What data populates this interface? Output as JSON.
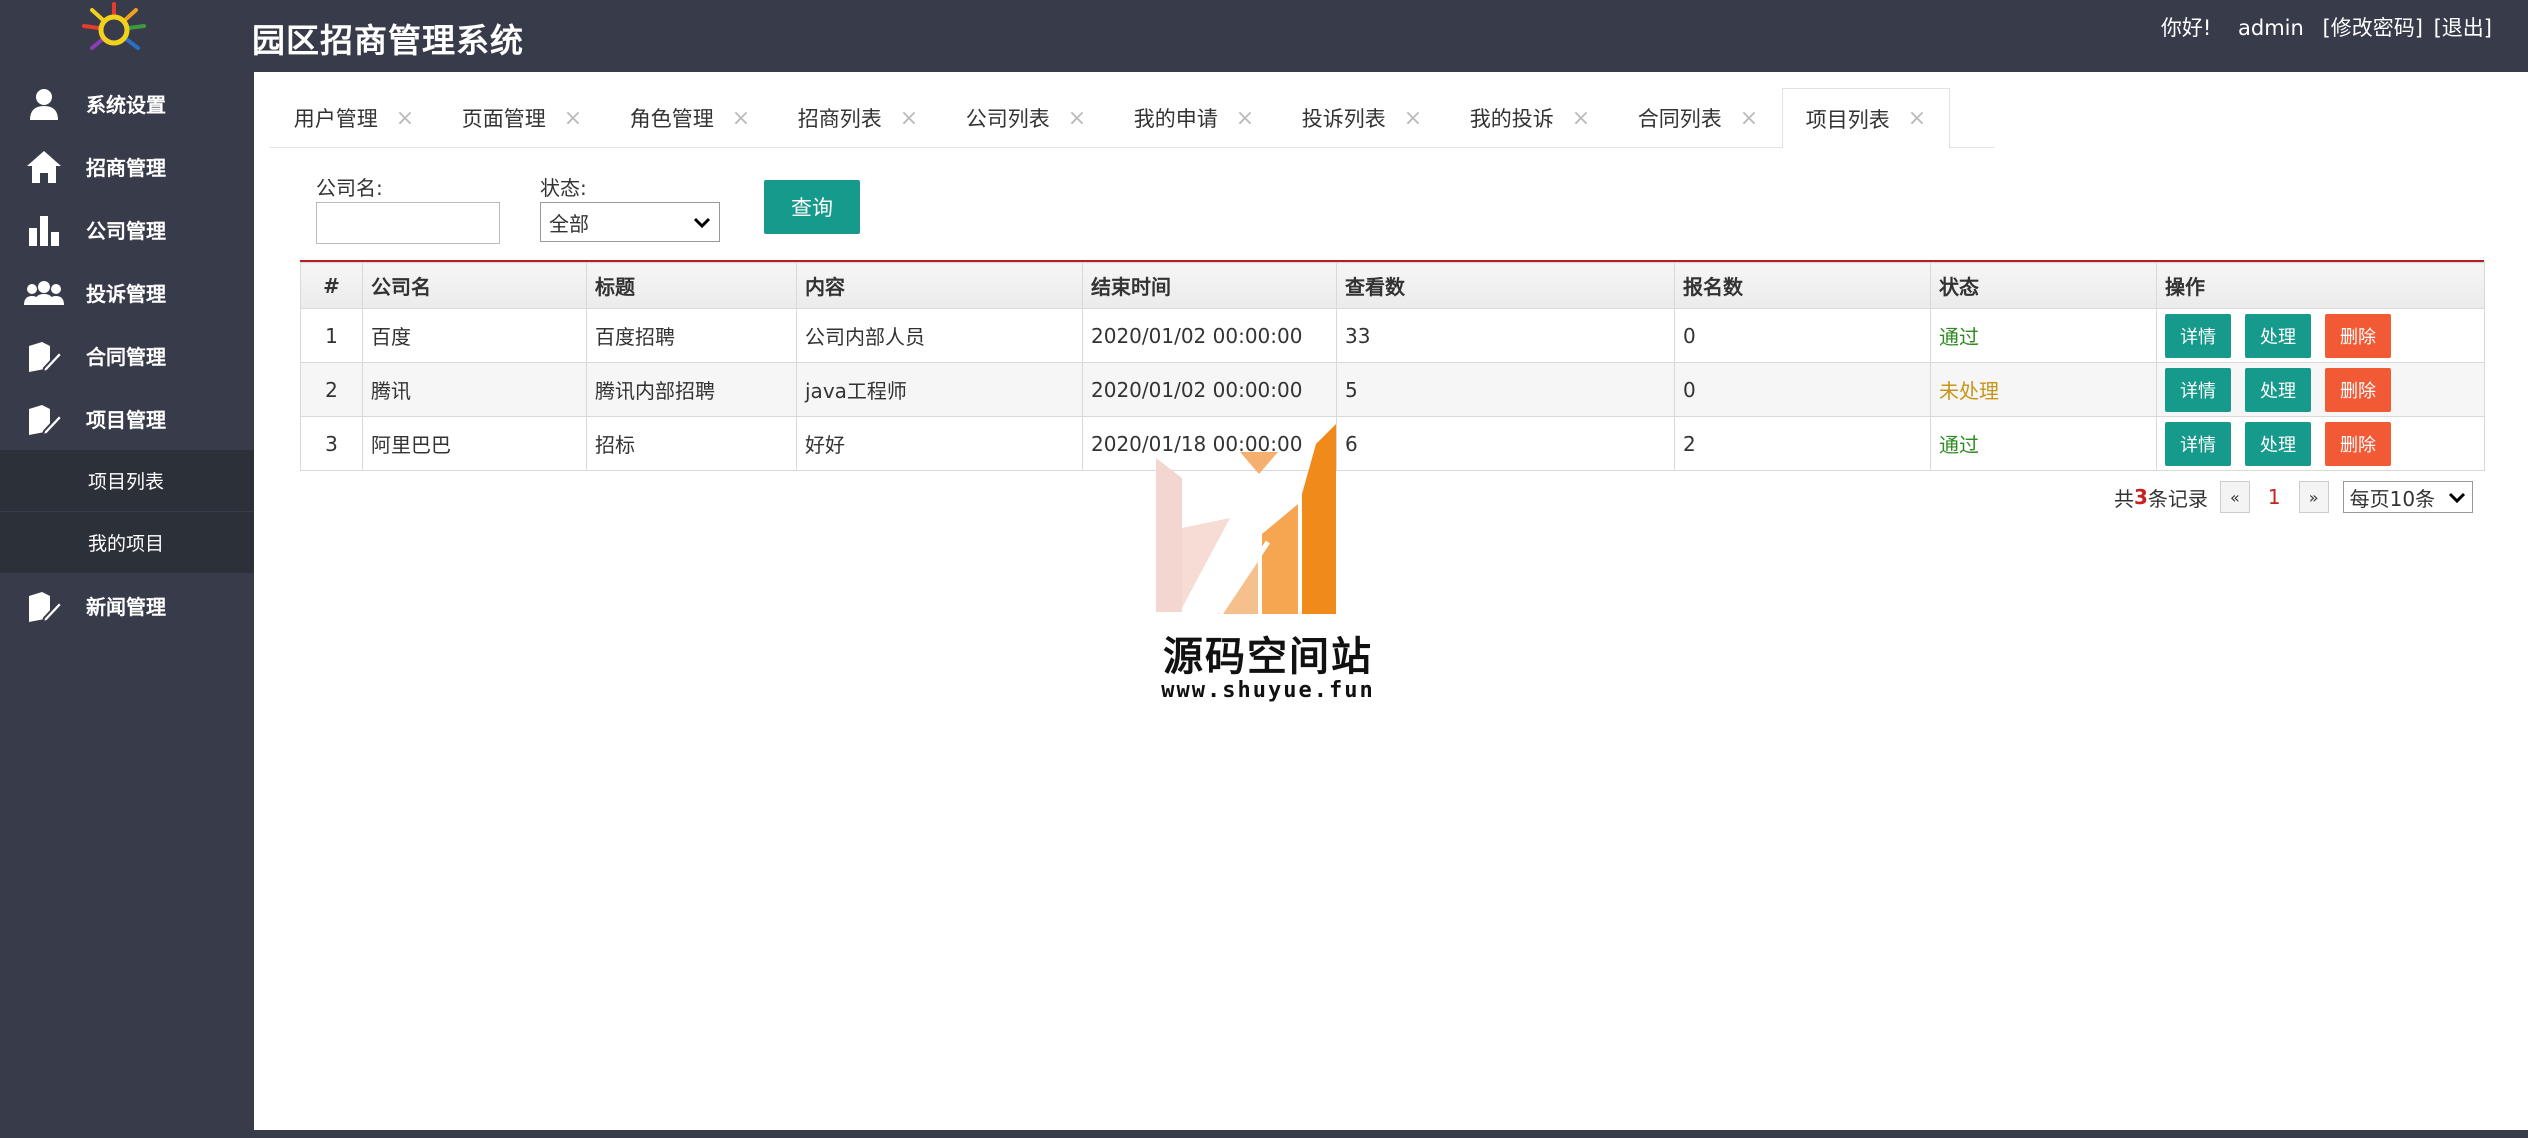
{
  "header": {
    "title": "园区招商管理系统",
    "greeting": "你好!",
    "username": "admin",
    "change_password": "[修改密码]",
    "logout": "[退出]"
  },
  "sidebar": {
    "items": [
      {
        "label": "系统设置",
        "icon": "user-icon"
      },
      {
        "label": "招商管理",
        "icon": "home-icon"
      },
      {
        "label": "公司管理",
        "icon": "chart-icon"
      },
      {
        "label": "投诉管理",
        "icon": "group-icon"
      },
      {
        "label": "合同管理",
        "icon": "edit-icon"
      },
      {
        "label": "项目管理",
        "icon": "edit-icon"
      },
      {
        "label": "新闻管理",
        "icon": "edit-icon"
      }
    ],
    "subitems": [
      {
        "label": "项目列表"
      },
      {
        "label": "我的项目"
      }
    ]
  },
  "tabs": [
    {
      "label": "用户管理"
    },
    {
      "label": "页面管理"
    },
    {
      "label": "角色管理"
    },
    {
      "label": "招商列表"
    },
    {
      "label": "公司列表"
    },
    {
      "label": "我的申请"
    },
    {
      "label": "投诉列表"
    },
    {
      "label": "我的投诉"
    },
    {
      "label": "合同列表"
    },
    {
      "label": "项目列表"
    }
  ],
  "tab_close": "×",
  "search": {
    "company_label": "公司名:",
    "company_value": "",
    "status_label": "状态:",
    "status_value": "全部",
    "query_button": "查询"
  },
  "table": {
    "headers": [
      "#",
      "公司名",
      "标题",
      "内容",
      "结束时间",
      "查看数",
      "报名数",
      "状态",
      "操作"
    ],
    "rows": [
      {
        "no": "1",
        "company": "百度",
        "title": "百度招聘",
        "content": "公司内部人员",
        "end_time": "2020/01/02 00:00:00",
        "views": "33",
        "signups": "0",
        "status": "通过"
      },
      {
        "no": "2",
        "company": "腾讯",
        "title": "腾讯内部招聘",
        "content": "java工程师",
        "end_time": "2020/01/02 00:00:00",
        "views": "5",
        "signups": "0",
        "status": "未处理"
      },
      {
        "no": "3",
        "company": "阿里巴巴",
        "title": "招标",
        "content": "好好",
        "end_time": "2020/01/18 00:00:00",
        "views": "6",
        "signups": "2",
        "status": "通过"
      }
    ],
    "actions": {
      "detail": "详情",
      "handle": "处理",
      "delete": "删除"
    }
  },
  "pagination": {
    "prefix": "共",
    "total": "3",
    "suffix": "条记录",
    "prev": "«",
    "current": "1",
    "next": "»",
    "page_size": "每页10条"
  },
  "watermark": {
    "title": "源码空间站",
    "url": "www.shuyue.fun"
  },
  "colors": {
    "dark": "#383c4a",
    "teal": "#169a8b",
    "orange": "#f25a35",
    "pass": "#2e8b22",
    "pending": "#c7951a",
    "accent_red": "#b71f24"
  }
}
